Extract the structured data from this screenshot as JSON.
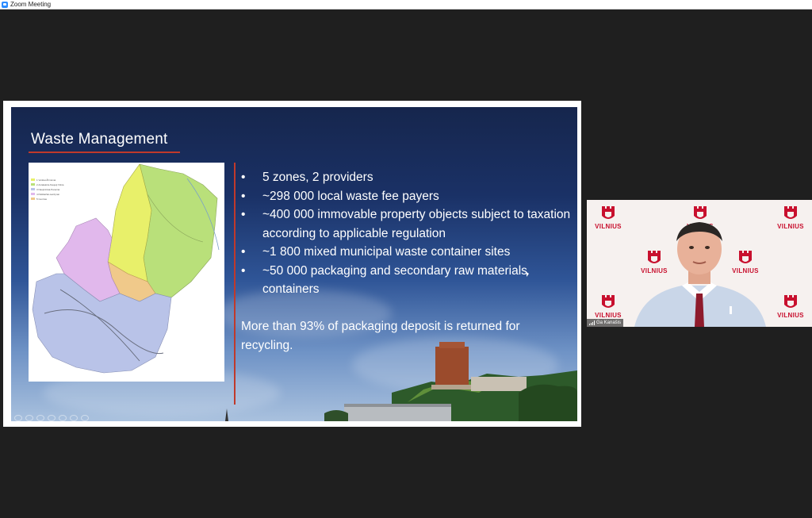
{
  "window": {
    "title": "Zoom Meeting",
    "app_icon": "zoom-icon"
  },
  "slide": {
    "title": "Waste Management",
    "bullets": [
      "5 zones, 2 providers",
      "~298 000 local waste fee payers",
      "~400 000 immovable property objects subject to taxation according to applicable regulation",
      "~1 800 mixed municipal waste container sites",
      "~50 000 packaging and secondary raw materials containers"
    ],
    "note": "More than 93% of packaging deposit is returned for recycling.",
    "map_legend": [
      "1 Verkiai-Žirmūnai",
      "2 Antakalnis-Naujoji Vilnia",
      "3 Naujininkai-Paneriai",
      "4 Pašilaičiai-Lazdynai",
      "5 Centras"
    ]
  },
  "participant": {
    "name": "Ga Kanašis",
    "logo_text": "VILNIUS"
  },
  "colors": {
    "accent_red": "#c0392b",
    "zoom_blue": "#2d8cff",
    "logo_red": "#c8102e"
  }
}
